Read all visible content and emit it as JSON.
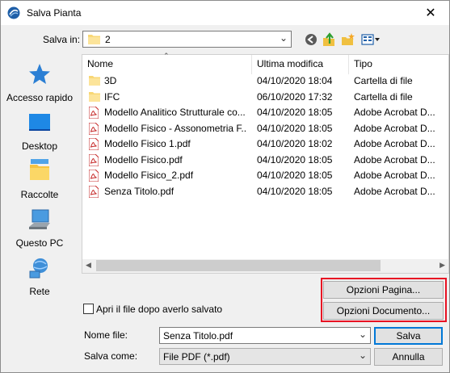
{
  "window": {
    "title": "Salva Pianta",
    "close_glyph": "✕"
  },
  "toolbar": {
    "lookin_label": "Salva in:",
    "lookin_value": "2",
    "back_icon": "back-arrow-icon",
    "up_icon": "up-folder-icon",
    "new_folder_icon": "new-folder-icon",
    "view_icon": "view-menu-icon"
  },
  "places": [
    {
      "label": "Accesso rapido",
      "icon": "star-icon"
    },
    {
      "label": "Desktop",
      "icon": "desktop-icon"
    },
    {
      "label": "Raccolte",
      "icon": "libraries-icon"
    },
    {
      "label": "Questo PC",
      "icon": "computer-icon"
    },
    {
      "label": "Rete",
      "icon": "network-icon"
    }
  ],
  "list": {
    "columns": [
      "Nome",
      "Ultima modifica",
      "Tipo"
    ],
    "rows": [
      {
        "name": "3D",
        "date": "04/10/2020 18:04",
        "type": "Cartella di file",
        "kind": "folder"
      },
      {
        "name": "IFC",
        "date": "06/10/2020 17:32",
        "type": "Cartella di file",
        "kind": "folder"
      },
      {
        "name": "Modello Analitico Strutturale co...",
        "date": "04/10/2020 18:05",
        "type": "Adobe Acrobat D...",
        "kind": "pdf"
      },
      {
        "name": "Modello Fisico - Assonometria F...",
        "date": "04/10/2020 18:05",
        "type": "Adobe Acrobat D...",
        "kind": "pdf"
      },
      {
        "name": "Modello Fisico 1.pdf",
        "date": "04/10/2020 18:02",
        "type": "Adobe Acrobat D...",
        "kind": "pdf"
      },
      {
        "name": "Modello Fisico.pdf",
        "date": "04/10/2020 18:05",
        "type": "Adobe Acrobat D...",
        "kind": "pdf"
      },
      {
        "name": "Modello Fisico_2.pdf",
        "date": "04/10/2020 18:05",
        "type": "Adobe Acrobat D...",
        "kind": "pdf"
      },
      {
        "name": "Senza Titolo.pdf",
        "date": "04/10/2020 18:05",
        "type": "Adobe Acrobat D...",
        "kind": "pdf"
      }
    ]
  },
  "options": {
    "page_button": "Opzioni Pagina...",
    "document_button": "Opzioni Documento...",
    "highlight_color": "#e81123"
  },
  "open_after": {
    "label": "Apri il file dopo averlo salvato",
    "checked": false
  },
  "filename": {
    "label": "Nome file:",
    "value": "Senza Titolo.pdf"
  },
  "filetype": {
    "label": "Salva come:",
    "value": "File PDF (*.pdf)"
  },
  "buttons": {
    "save": "Salva",
    "cancel": "Annulla"
  }
}
